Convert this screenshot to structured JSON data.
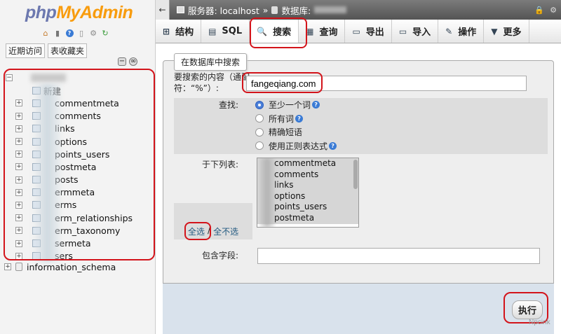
{
  "logo": {
    "part1": "php",
    "part2": "MyAdmin"
  },
  "nav": {
    "icons": [
      "home-icon",
      "database-icon",
      "help-icon",
      "document-icon",
      "gear-icon",
      "refresh-icon"
    ],
    "recent_label": "近期访问",
    "favorites_label": "表收藏夹",
    "new_label": "新建",
    "tables": [
      "commentmeta",
      "comments",
      "links",
      "options",
      "points_users",
      "postmeta",
      "posts",
      "ermmeta",
      "erms",
      "erm_relationships",
      "erm_taxonomy",
      "sermeta",
      "sers"
    ],
    "other_db": "information_schema"
  },
  "topbar": {
    "back_glyph": "←",
    "server_label": "服务器: localhost",
    "sep": "»",
    "db_label": "数据库:"
  },
  "tabs": [
    {
      "label": "结构",
      "icon": "structure-icon",
      "glyph": "⊞"
    },
    {
      "label": "SQL",
      "icon": "sql-icon",
      "glyph": "▤"
    },
    {
      "label": "搜索",
      "icon": "search-icon",
      "glyph": "🔍"
    },
    {
      "label": "查询",
      "icon": "query-icon",
      "glyph": "▦"
    },
    {
      "label": "导出",
      "icon": "export-icon",
      "glyph": "▭"
    },
    {
      "label": "导入",
      "icon": "import-icon",
      "glyph": "▭"
    },
    {
      "label": "操作",
      "icon": "wrench-icon",
      "glyph": "✎"
    },
    {
      "label": "更多",
      "icon": "dropdown-icon",
      "glyph": "▼"
    }
  ],
  "form": {
    "legend": "在数据库中搜索",
    "term_label": "要搜索的内容（通配符：“%”）:",
    "term_value": "fangeqiang.com",
    "find_label": "查找:",
    "options": [
      "至少一个词",
      "所有词",
      "精确短语",
      "使用正则表达式"
    ],
    "tables_label": "于下列表:",
    "table_options": [
      "commentmeta",
      "comments",
      "links",
      "options",
      "points_users",
      "postmeta"
    ],
    "select_all": "全选",
    "divider": "/",
    "select_none": "全不选",
    "column_label": "包含字段:",
    "submit": "执行"
  },
  "watermark": "Npcink"
}
